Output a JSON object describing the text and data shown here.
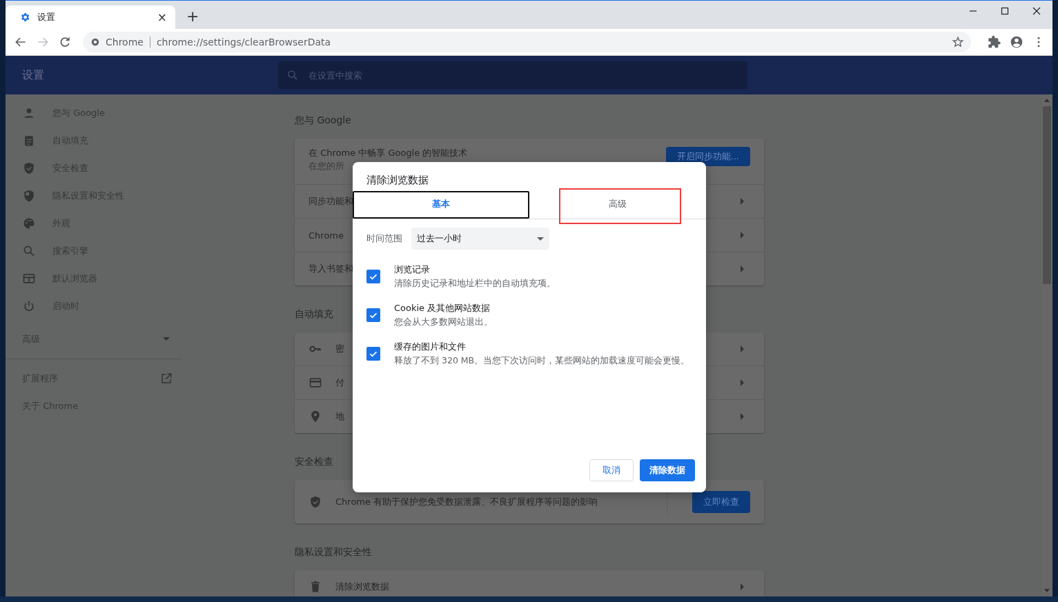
{
  "browser_tab": {
    "title": "设置",
    "close": "×",
    "new_tab": "+"
  },
  "address_bar": {
    "site": "Chrome",
    "url": "chrome://settings/clearBrowserData"
  },
  "header": {
    "title": "设置",
    "search_placeholder": "在设置中搜索"
  },
  "sidebar": {
    "items": [
      {
        "kind": "person",
        "label": "您与 Google"
      },
      {
        "kind": "clipboard",
        "label": "自动填充"
      },
      {
        "kind": "shield-check",
        "label": "安全检查"
      },
      {
        "kind": "shield-half",
        "label": "隐私设置和安全性"
      },
      {
        "kind": "palette",
        "label": "外观"
      },
      {
        "kind": "search",
        "label": "搜索引擎"
      },
      {
        "kind": "browser",
        "label": "默认浏览器"
      },
      {
        "kind": "power",
        "label": "启动时"
      }
    ],
    "advanced": {
      "label": "高级",
      "expanded": false
    },
    "extensions": "扩展程序",
    "about": "关于 Chrome"
  },
  "sections": [
    {
      "title": "您与 Google",
      "rows": [
        {
          "kind": "promo",
          "label": "在 Chrome 中畅享 Google 的智能技术",
          "subtitle": "在您的所",
          "button": "开启同步功能..."
        },
        {
          "kind": "link",
          "label": "同步功能和"
        },
        {
          "kind": "link",
          "label": "Chrome"
        },
        {
          "kind": "link",
          "label": "导入书签和"
        }
      ]
    },
    {
      "title": "自动填充",
      "rows": [
        {
          "kind": "link",
          "label": "密"
        },
        {
          "kind": "link",
          "label": "付"
        },
        {
          "kind": "link",
          "label": "地"
        }
      ]
    },
    {
      "title": "安全检查",
      "rows": [
        {
          "kind": "action",
          "label": "Chrome 有助于保护您免受数据泄露、不良扩展程序等问题的影响",
          "button": "立即检查"
        }
      ]
    },
    {
      "title": "隐私设置和安全性",
      "rows": [
        {
          "kind": "link",
          "label": "清除浏览数据"
        }
      ]
    }
  ],
  "dialog": {
    "title": "清除浏览数据",
    "tabs": [
      {
        "label": "基本",
        "selected": true,
        "focused": true,
        "highlighted": false
      },
      {
        "label": "高级",
        "selected": false,
        "focused": false,
        "highlighted": true
      }
    ],
    "time_range": {
      "label": "时间范围",
      "value": "过去一小时"
    },
    "options": [
      {
        "title": "浏览记录",
        "description": "清除历史记录和地址栏中的自动填充项。",
        "checked": true
      },
      {
        "title": "Cookie 及其他网站数据",
        "description": "您会从大多数网站退出。",
        "checked": true
      },
      {
        "title": "缓存的图片和文件",
        "description": "释放了不到 320 MB。当您下次访问时，某些网站的加载速度可能会更慢。",
        "checked": true
      }
    ],
    "cancel": "取消",
    "confirm": "清除数据"
  }
}
